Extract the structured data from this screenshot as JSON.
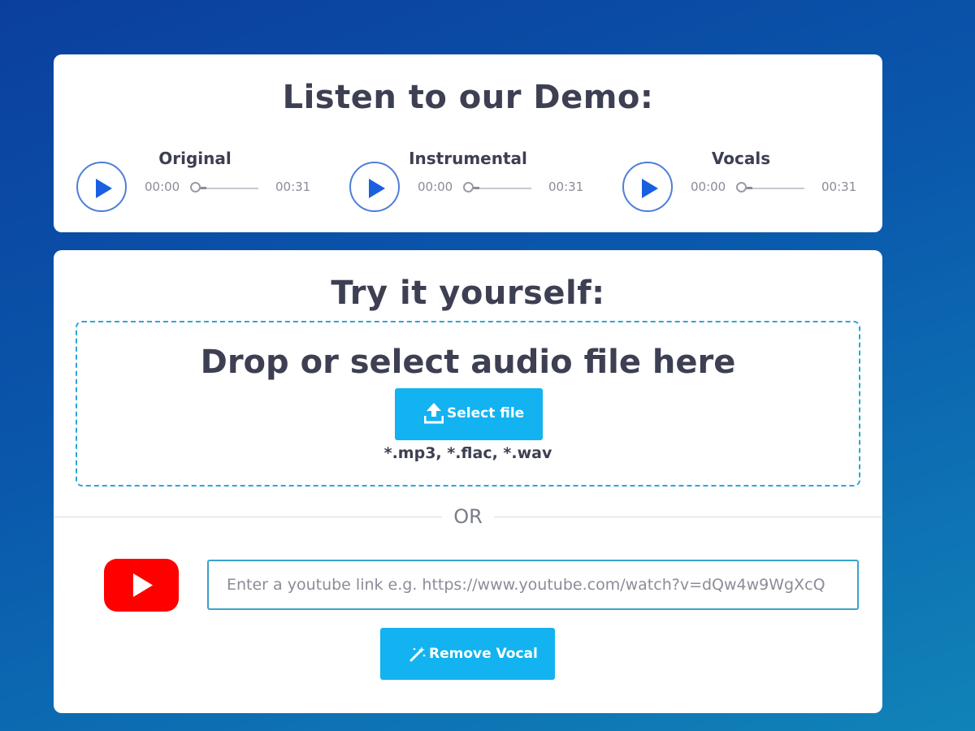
{
  "demo": {
    "title": "Listen to our Demo:",
    "players": [
      {
        "label": "Original",
        "current_time": "00:00",
        "duration": "00:31",
        "progress": 0
      },
      {
        "label": "Instrumental",
        "current_time": "00:00",
        "duration": "00:31",
        "progress": 0
      },
      {
        "label": "Vocals",
        "current_time": "00:00",
        "duration": "00:31",
        "progress": 0
      }
    ]
  },
  "upload": {
    "title": "Try it yourself:",
    "drop_title": "Drop or select audio file here",
    "select_label": "Select file",
    "formats": "*.mp3, *.flac, *.wav",
    "or_label": "OR",
    "youtube_placeholder": "Enter a youtube link e.g. https://www.youtube.com/watch?v=dQw4w9WgXcQ",
    "youtube_value": "",
    "remove_label": "Remove Vocal"
  },
  "colors": {
    "accent": "#12b3f0",
    "play_icon": "#1a5fe0",
    "youtube_red": "#ff0000",
    "heading": "#3d3f52"
  },
  "icons": {
    "play": "play-icon",
    "upload": "upload-icon",
    "youtube": "youtube-logo-icon",
    "magic_wand": "magic-wand-icon"
  }
}
